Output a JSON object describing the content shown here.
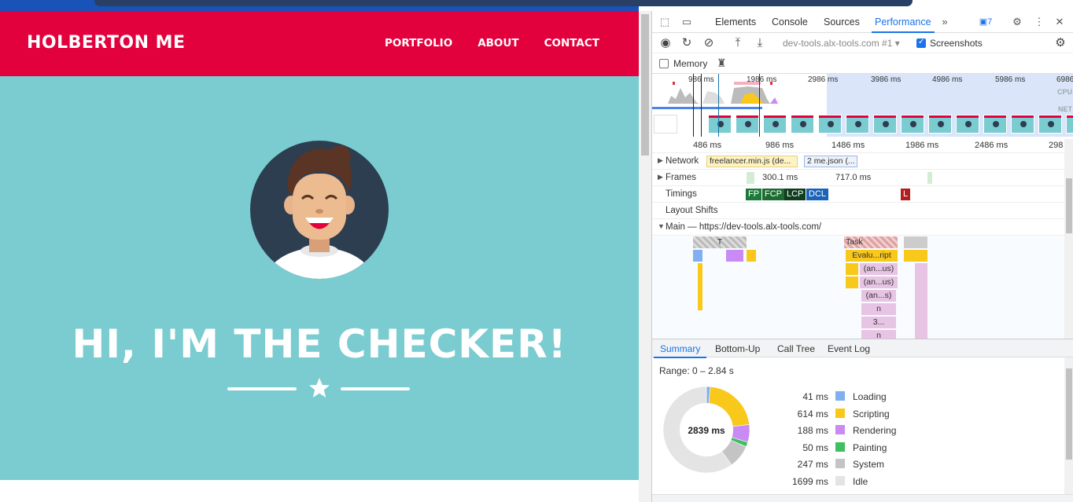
{
  "page": {
    "brand": "HOLBERTON ME",
    "nav": [
      "PORTFOLIO",
      "ABOUT",
      "CONTACT"
    ],
    "headline": "HI, I'M THE CHECKER!",
    "colors": {
      "nav": "#e2003d",
      "hero": "#7accd1"
    }
  },
  "devtools": {
    "tabs": [
      "Elements",
      "Console",
      "Sources",
      "Performance"
    ],
    "active_tab": "Performance",
    "issues_count": "7",
    "recording_url": "dev-tools.alx-tools.com #1",
    "screenshots_label": "Screenshots",
    "screenshots_checked": true,
    "memory_label": "Memory",
    "memory_checked": false,
    "overview_ticks": [
      "986 ms",
      "1986 ms",
      "2986 ms",
      "3986 ms",
      "4986 ms",
      "5986 ms",
      "6986"
    ],
    "overview_side": [
      "CPU",
      "NET"
    ],
    "ruler_ticks": [
      "486 ms",
      "986 ms",
      "1486 ms",
      "1986 ms",
      "2486 ms",
      "298"
    ],
    "tracks": {
      "network": "Network",
      "network_items": [
        "freelancer.min.js (de...",
        "2 me.json (..."
      ],
      "frames": "Frames",
      "frame_values": [
        "300.1 ms",
        "717.0 ms"
      ],
      "timings": "Timings",
      "timing_marks": [
        "FP",
        "FCP",
        "LCP",
        "DCL",
        "L"
      ],
      "layout_shifts": "Layout Shifts",
      "main": "Main — https://dev-tools.alx-tools.com/"
    },
    "flame": {
      "task_left": "T",
      "task_right": "Task",
      "evaluate": "Evalu...ript",
      "anon1": "(an...us)",
      "anon2": "(an...us)",
      "anon3": "(an...s)",
      "n1": "n",
      "three": "3...",
      "n2": "n"
    },
    "summary_tabs": [
      "Summary",
      "Bottom-Up",
      "Call Tree",
      "Event Log"
    ],
    "range": "Range: 0 – 2.84 s",
    "total": "2839 ms",
    "categories": [
      {
        "ms": "41 ms",
        "name": "Loading",
        "color": "#80b0f0"
      },
      {
        "ms": "614 ms",
        "name": "Scripting",
        "color": "#f8c81a"
      },
      {
        "ms": "188 ms",
        "name": "Rendering",
        "color": "#c98af5"
      },
      {
        "ms": "50 ms",
        "name": "Painting",
        "color": "#3fbf5f"
      },
      {
        "ms": "247 ms",
        "name": "System",
        "color": "#c4c4c4"
      },
      {
        "ms": "1699 ms",
        "name": "Idle",
        "color": "#e4e4e4"
      }
    ],
    "category_values": [
      41,
      614,
      188,
      50,
      247,
      1699
    ]
  }
}
